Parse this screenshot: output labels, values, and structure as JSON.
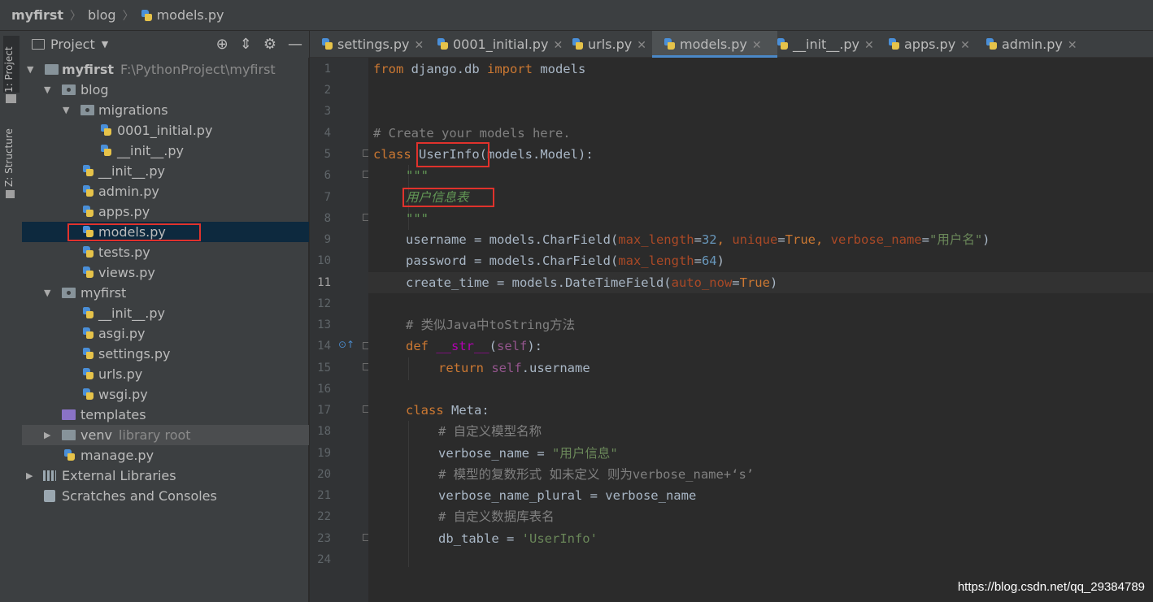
{
  "breadcrumb": {
    "items": [
      "myfirst",
      "blog",
      "models.py"
    ]
  },
  "stripe": {
    "project_label": "1: Project",
    "structure_label": "Z: Structure"
  },
  "project_panel": {
    "title": "Project",
    "tools": {
      "locate": "⊕",
      "collapse": "⇕",
      "settings": "⚙",
      "hide": "—"
    },
    "tree": [
      {
        "label": "myfirst",
        "suffix": "F:\\PythonProject\\myfirst"
      },
      {
        "label": "blog"
      },
      {
        "label": "migrations"
      },
      {
        "label": "0001_initial.py"
      },
      {
        "label": "__init__.py"
      },
      {
        "label": "__init__.py"
      },
      {
        "label": "admin.py"
      },
      {
        "label": "apps.py"
      },
      {
        "label": "models.py"
      },
      {
        "label": "tests.py"
      },
      {
        "label": "views.py"
      },
      {
        "label": "myfirst"
      },
      {
        "label": "__init__.py"
      },
      {
        "label": "asgi.py"
      },
      {
        "label": "settings.py"
      },
      {
        "label": "urls.py"
      },
      {
        "label": "wsgi.py"
      },
      {
        "label": "templates"
      },
      {
        "label": "venv",
        "suffix": "library root"
      },
      {
        "label": "manage.py"
      },
      {
        "label": "External Libraries"
      },
      {
        "label": "Scratches and Consoles"
      }
    ]
  },
  "tabs": [
    {
      "label": "settings.py"
    },
    {
      "label": "0001_initial.py"
    },
    {
      "label": "urls.py"
    },
    {
      "label": "models.py",
      "active": true
    },
    {
      "label": "__init__.py"
    },
    {
      "label": "apps.py"
    },
    {
      "label": "admin.py"
    }
  ],
  "editor": {
    "current_line": 11,
    "line_numbers": [
      "1",
      "2",
      "3",
      "4",
      "5",
      "6",
      "7",
      "8",
      "9",
      "10",
      "11",
      "12",
      "13",
      "14",
      "15",
      "16",
      "17",
      "18",
      "19",
      "20",
      "21",
      "22",
      "23",
      "24"
    ],
    "code": {
      "l1": {
        "kw1": "from",
        "mod": " django.db ",
        "kw2": "import",
        "name": " models"
      },
      "l4": {
        "comment": "# Create your models here."
      },
      "l5": {
        "kw": "class",
        "sp": " ",
        "cls": "UserInfo",
        "rest": "(models.Model):"
      },
      "l6": {
        "doc": "\"\"\""
      },
      "l7": {
        "doc": "用户信息表"
      },
      "l8": {
        "doc": "\"\"\""
      },
      "l9": {
        "a": "username = models.CharField(",
        "p1": "max_length",
        "eq1": "=",
        "n1": "32",
        "c1": ", ",
        "p2": "unique",
        "eq2": "=",
        "k2": "True",
        "c2": ", ",
        "p3": "verbose_name",
        "eq3": "=",
        "s3": "\"用户名\"",
        "end": ")"
      },
      "l10": {
        "a": "password = models.CharField(",
        "p1": "max_length",
        "eq1": "=",
        "n1": "64",
        "end": ")"
      },
      "l11": {
        "a": "create_time = models.DateTimeField(",
        "p1": "auto_now",
        "eq1": "=",
        "k1": "True",
        "end": ")"
      },
      "l13": {
        "comment": "# 类似Java中toString方法"
      },
      "l14": {
        "kw": "def",
        "sp": " ",
        "fn": "__str__",
        "op": "(",
        "self": "self",
        "end": "):"
      },
      "l15": {
        "kw": "return",
        "sp": " ",
        "self": "self",
        "end": ".username"
      },
      "l17": {
        "kw": "class",
        "rest": " Meta:"
      },
      "l18": {
        "comment": "# 自定义模型名称"
      },
      "l19": {
        "a": "verbose_name = ",
        "s": "\"用户信息\""
      },
      "l20": {
        "comment": "# 模型的复数形式 如未定义 则为verbose_name+‘s’"
      },
      "l21": {
        "a": "verbose_name_plural = verbose_name"
      },
      "l22": {
        "comment": "# 自定义数据库表名"
      },
      "l23": {
        "a": "db_table = ",
        "s": "'UserInfo'"
      }
    }
  },
  "watermark": "https://blog.csdn.net/qq_29384789",
  "colors": {
    "keyword": "#cc7832",
    "string": "#6a8759",
    "comment": "#808080",
    "docstring": "#629755",
    "param": "#aa4926",
    "number": "#6897bb",
    "selection": "#0d293e",
    "highlight_box": "#e0322c"
  }
}
